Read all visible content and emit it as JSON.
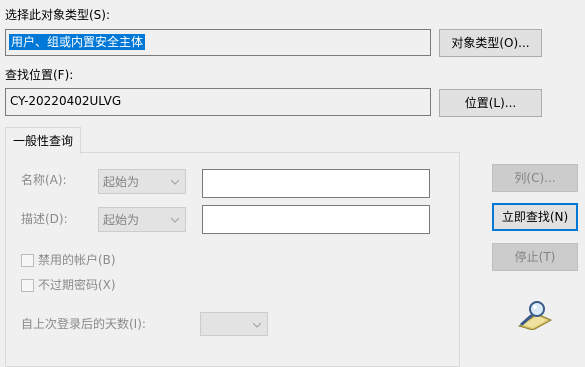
{
  "object_type": {
    "label": "选择此对象类型(S):",
    "value": "用户、组或内置安全主体",
    "button": "对象类型(O)..."
  },
  "location": {
    "label": "查找位置(F):",
    "value": "CY-20220402ULVG",
    "button": "位置(L)..."
  },
  "tab": {
    "label": "一般性查询"
  },
  "query": {
    "name_label": "名称(A):",
    "name_mode": "起始为",
    "desc_label": "描述(D):",
    "desc_mode": "起始为",
    "disabled_accounts": "禁用的帐户(B)",
    "non_expiring_pw": "不过期密码(X)",
    "days_label": "自上次登录后的天数(I):"
  },
  "side_buttons": {
    "columns": "列(C)...",
    "find_now": "立即查找(N)",
    "stop": "停止(T)"
  },
  "icons": {
    "search_animation": "magnifier-search-icon"
  }
}
